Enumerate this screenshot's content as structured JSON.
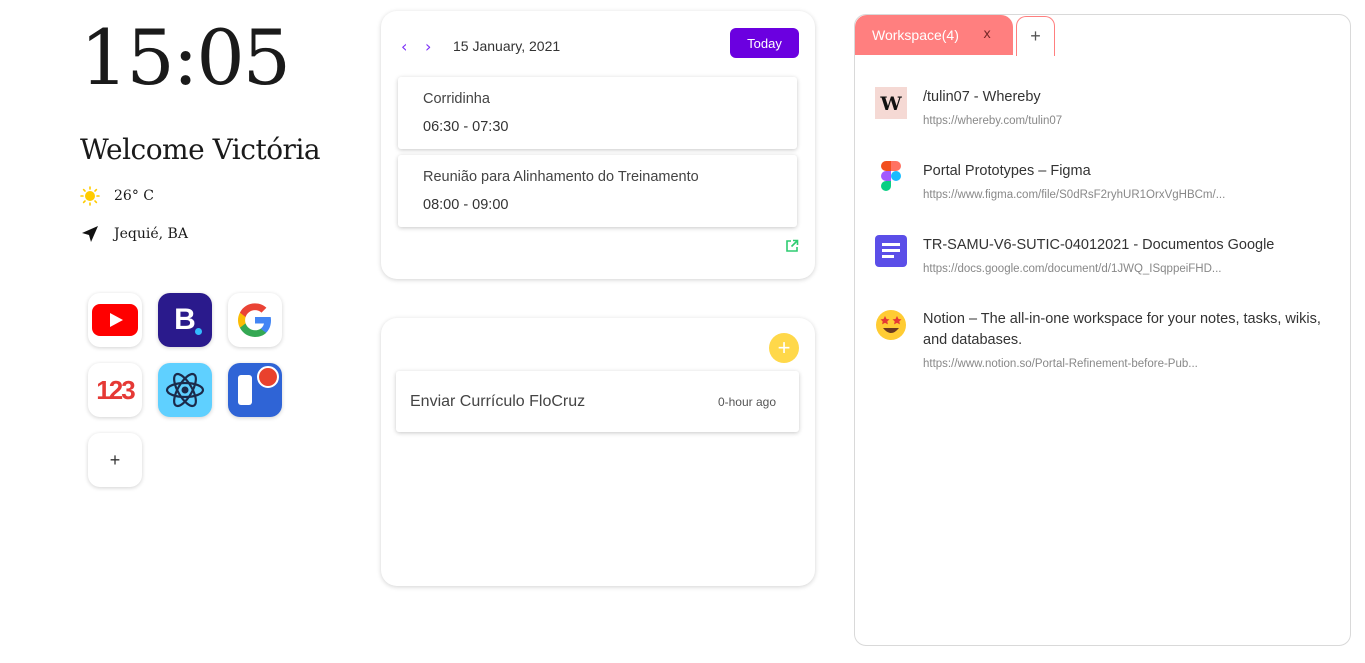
{
  "clock": {
    "time": "15:05"
  },
  "welcome": {
    "text": "Welcome Victória"
  },
  "weather": {
    "temp": "26° C",
    "icon": "sun-icon"
  },
  "location": {
    "text": "Jequié, BA",
    "icon": "location-arrow-icon"
  },
  "apps": [
    {
      "name": "youtube",
      "icon": "youtube-icon"
    },
    {
      "name": "booking",
      "icon": "booking-icon",
      "letter": "B"
    },
    {
      "name": "google",
      "icon": "google-icon",
      "letter": "G"
    },
    {
      "name": "123",
      "icon": "numbers-icon",
      "letter": "123"
    },
    {
      "name": "react",
      "icon": "react-icon"
    },
    {
      "name": "trello",
      "icon": "trello-icon"
    }
  ],
  "add_app": {
    "label": "+"
  },
  "calendar": {
    "prev": "‹",
    "next": "›",
    "date": "15 January, 2021",
    "today_label": "Today",
    "events": [
      {
        "title": "Corridinha",
        "time": "06:30 - 07:30"
      },
      {
        "title": "Reunião para Alinhamento do Treinamento",
        "time": "08:00 - 09:00"
      }
    ],
    "link_icon": "external-link-icon"
  },
  "todo": {
    "add_label": "+",
    "items": [
      {
        "text": "Enviar Currículo FloCruz",
        "time": "0-hour ago"
      }
    ]
  },
  "workspace": {
    "tab_label": "Workspace(4)",
    "tab_close": "x",
    "add_tab": "+",
    "items": [
      {
        "icon": "whereby-icon",
        "title": "/tulin07 - Whereby",
        "url": "https://whereby.com/tulin07"
      },
      {
        "icon": "figma-icon",
        "title": "Portal Prototypes – Figma",
        "url": "https://www.figma.com/file/S0dRsF2ryhUR1OrxVgHBCm/..."
      },
      {
        "icon": "google-docs-icon",
        "title": "TR-SAMU-V6-SUTIC-04012021 - Documentos Google",
        "url": "https://docs.google.com/document/d/1JWQ_ISqppeiFHD..."
      },
      {
        "icon": "notion-icon",
        "title": "Notion – The all-in-one workspace for your notes, tasks, wikis, and databases.",
        "url": "https://www.notion.so/Portal-Refinement-before-Pub..."
      }
    ]
  },
  "colors": {
    "accent": "#6b00e0",
    "workspace_tab": "#ff7f7f",
    "add_todo": "#ffd84a",
    "link": "#2ecc71"
  }
}
